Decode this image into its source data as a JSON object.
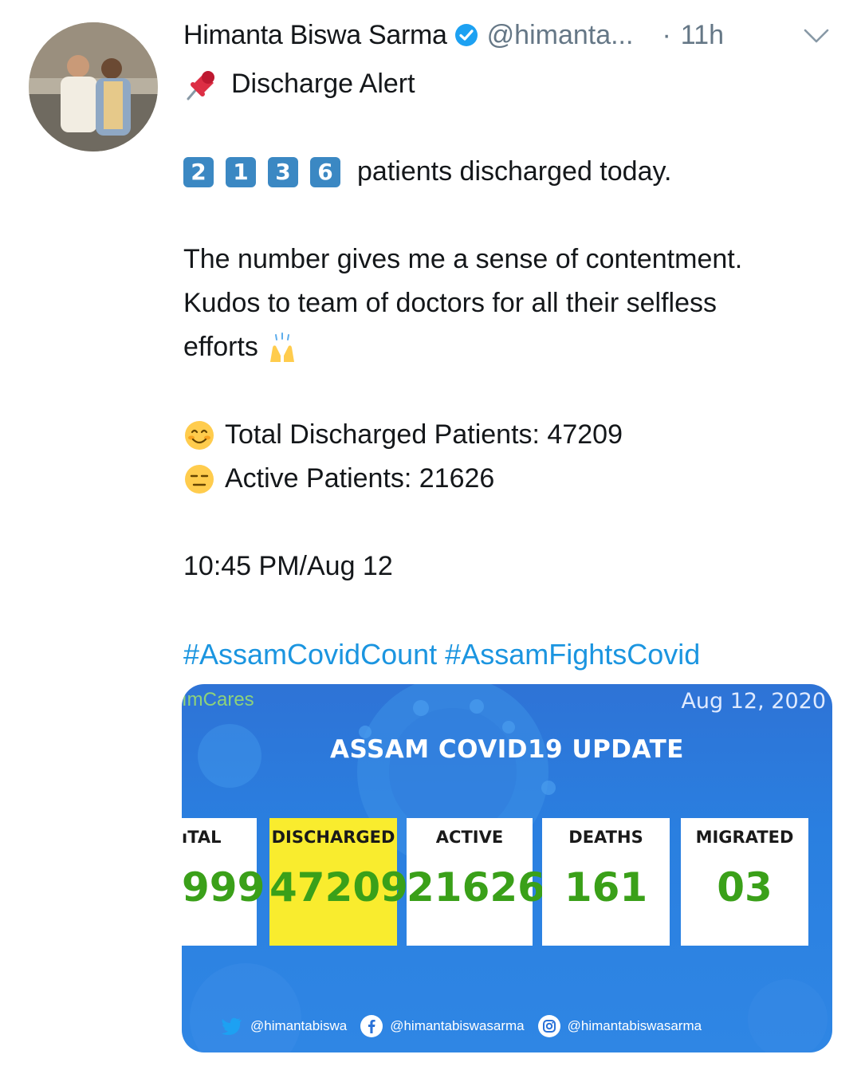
{
  "tweet": {
    "author_name": "Himanta Biswa Sarma",
    "author_handle": "@himanta...",
    "separator": "·",
    "time_ago": "11h",
    "lines": {
      "alert": "Discharge Alert",
      "discharged_digits": [
        "2",
        "1",
        "3",
        "6"
      ],
      "discharged_text": "patients discharged today.",
      "p1": "The number gives me a sense of contentment.",
      "p2": "Kudos to team of doctors for all their selfless",
      "p3": "efforts",
      "total": "Total Discharged Patients: 47209",
      "active": "Active Patients: 21626",
      "timestamp": "10:45 PM/Aug 12",
      "hashtag1": "#AssamCovidCount",
      "hashtag2": "#AssamFightsCovid"
    },
    "icons": {
      "pin": "pushpin-emoji",
      "raised_hands": "raised-hands-emoji",
      "smiling": "smiling-face-emoji",
      "expressionless": "expressionless-face-emoji"
    }
  },
  "media": {
    "brand": "ımCares",
    "date": "Aug 12, 2020",
    "title": "ASSAM COVID19 UPDATE",
    "stats": [
      {
        "label": "ıTAL",
        "value": "999"
      },
      {
        "label": "DISCHARGED",
        "value": "47209"
      },
      {
        "label": "ACTIVE",
        "value": "21626"
      },
      {
        "label": "DEATHS",
        "value": "161"
      },
      {
        "label": "MIGRATED",
        "value": "03"
      }
    ],
    "socials": {
      "twitter": "@himantabiswa",
      "facebook": "@himantabiswasarma",
      "instagram": "@himantabiswasarma"
    }
  },
  "colors": {
    "link": "#1b95e0",
    "muted": "#657786",
    "keycap": "#3b88c3",
    "highlight": "#f9ec2e",
    "stat_value": "#3aa019"
  }
}
